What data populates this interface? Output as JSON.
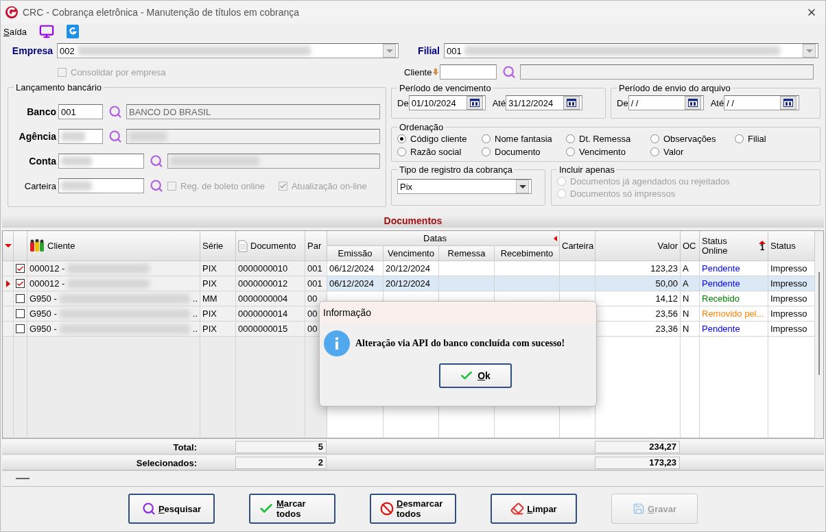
{
  "window": {
    "title": "CRC - Cobrança eletrônica - Manutenção de títulos em cobrança"
  },
  "menu": [
    {
      "label": "Saída",
      "kind": "text"
    },
    {
      "kind": "monitor"
    },
    {
      "kind": "logo"
    }
  ],
  "empresa": {
    "label": "Empresa",
    "value": "002"
  },
  "consolidar": {
    "label": "Consolidar por empresa",
    "checked": false
  },
  "filial": {
    "label": "Filial",
    "value": "001"
  },
  "cliente": {
    "label": "Cliente"
  },
  "lancamento": {
    "title": "Lançamento bancário",
    "fields": [
      {
        "label": "Banco",
        "required": true,
        "code": "001",
        "name": "BANCO DO BRASIL",
        "wide": false
      },
      {
        "label": "Agência",
        "required": true,
        "wide": false
      },
      {
        "label": "Conta",
        "required": true,
        "wide": true
      },
      {
        "label": "Carteira",
        "required": false,
        "wide": true
      }
    ],
    "options": [
      {
        "label": "Reg. de boleto online",
        "checked": false
      },
      {
        "label": "Atualização on-line",
        "checked": true
      }
    ]
  },
  "vencimento": {
    "title": "Período de vencimento",
    "from_label": "De",
    "from": "01/10/2024",
    "to_label": "Até",
    "to": "31/12/2024"
  },
  "envio": {
    "title": "Período de envio do arquivo",
    "from_label": "De",
    "from": " /  /",
    "to_label": "Até",
    "to": " /  /"
  },
  "ordenacao": {
    "title": "Ordenação",
    "options": [
      {
        "label": "Código cliente",
        "selected": true
      },
      {
        "label": "Nome fantasia",
        "selected": false
      },
      {
        "label": "Dt. Remessa",
        "selected": false
      },
      {
        "label": "Observações",
        "selected": false
      },
      {
        "label": "Filial",
        "selected": false
      },
      {
        "label": "Razão social",
        "selected": false
      },
      {
        "label": "Documento",
        "selected": false
      },
      {
        "label": "Vencimento",
        "selected": false
      },
      {
        "label": "Valor",
        "selected": false
      }
    ]
  },
  "tipo": {
    "title": "Tipo de registro da cobrança",
    "value": "Pix"
  },
  "incluir": {
    "title": "Incluir apenas",
    "options": [
      {
        "label": "Documentos já agendados ou rejeitados",
        "selected": false
      },
      {
        "label": "Documentos só impressos",
        "selected": false
      }
    ]
  },
  "documentos": {
    "title": "Documentos",
    "columns": {
      "cliente": "Cliente",
      "serie": "Série",
      "documento": "Documento",
      "par": "Par",
      "datas": "Datas",
      "emissao": "Emissão",
      "vencimento": "Vencimento",
      "remessa": "Remessa",
      "recebimento": "Recebimento",
      "carteira": "Carteira",
      "valor": "Valor",
      "oc": "OC",
      "status_online": "Status Online",
      "sort_index": "1",
      "status": "Status"
    },
    "rows": [
      {
        "checked": true,
        "current": false,
        "cliente": "000012 -",
        "cliente_tail": "",
        "serie": "PIX",
        "documento": "0000000010",
        "par": "001",
        "emissao": "06/12/2024",
        "vencimento": "20/12/2024",
        "valor": "123,23",
        "oc": "A",
        "status_online": "Pendente",
        "color": "#0000ff",
        "status": "Impresso"
      },
      {
        "checked": true,
        "current": true,
        "cliente": "000012 -",
        "cliente_tail": "",
        "serie": "PIX",
        "documento": "0000000012",
        "par": "001",
        "emissao": "06/12/2024",
        "vencimento": "20/12/2024",
        "valor": "50,00",
        "oc": "A",
        "status_online": "Pendente",
        "color": "#0000ff",
        "status": "Impresso"
      },
      {
        "checked": false,
        "current": false,
        "cliente": "G950 -",
        "cliente_tail": "..",
        "serie": "MM",
        "documento": "0000000004",
        "par": "00",
        "emissao": "",
        "vencimento": "",
        "valor": "14,12",
        "oc": "N",
        "status_online": "Recebido",
        "color": "#008000",
        "status": "Impresso"
      },
      {
        "checked": false,
        "current": false,
        "cliente": "G950 -",
        "cliente_tail": "..",
        "serie": "PIX",
        "documento": "0000000014",
        "par": "00",
        "emissao": "",
        "vencimento": "",
        "valor": "23,56",
        "oc": "N",
        "status_online": "Removido pel...",
        "color": "#ff8000",
        "status": "Impresso"
      },
      {
        "checked": false,
        "current": false,
        "cliente": "G950 -",
        "cliente_tail": "..",
        "serie": "PIX",
        "documento": "0000000015",
        "par": "00",
        "emissao": "",
        "vencimento": "",
        "valor": "23,36",
        "oc": "N",
        "status_online": "Pendente",
        "color": "#0000ff",
        "status": "Impresso"
      }
    ],
    "totals": [
      {
        "label": "Total:",
        "count": "5",
        "valor": "234,27"
      },
      {
        "label": "Selecionados:",
        "count": "2",
        "valor": "173,23"
      }
    ]
  },
  "dialog": {
    "title": "Informação",
    "message": "Alteração via API do banco concluída com sucesso!",
    "button": "Ok"
  },
  "buttons": [
    {
      "label": "Pesquisar",
      "kind": "search",
      "disabled": false
    },
    {
      "label": "Marcar todos",
      "kind": "check",
      "disabled": false
    },
    {
      "label": "Desmarcar todos",
      "kind": "ban",
      "disabled": false
    },
    {
      "label": "Limpar",
      "kind": "eraser",
      "disabled": false
    },
    {
      "label": "Gravar",
      "kind": "save",
      "disabled": true
    }
  ]
}
